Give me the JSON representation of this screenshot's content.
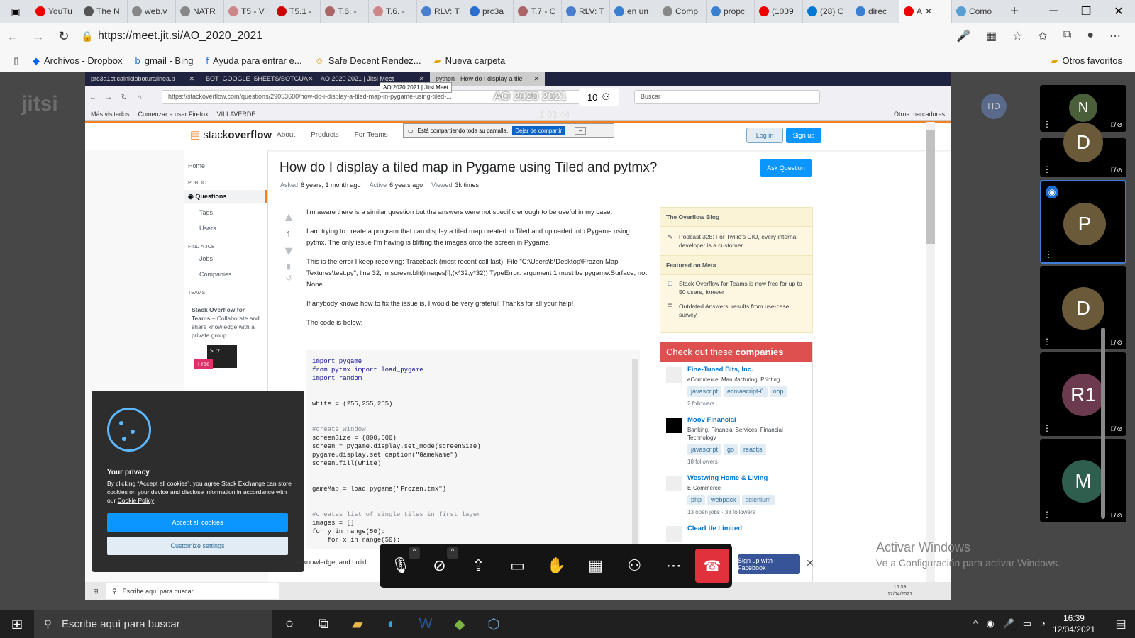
{
  "browser": {
    "tabs": [
      "YouTu",
      "The N",
      "web.v",
      "NATR",
      "T5 - V",
      "T5.1 -",
      "T.6. -",
      "T.6. -",
      "RLV: T",
      "prc3a",
      "T.7 - C",
      "RLV: T",
      "en un",
      "Comp",
      "propc",
      "(1039",
      "(28) C",
      "direc",
      "A",
      "Como"
    ],
    "active_tab_index": 18,
    "url": "https://meet.jit.si/AO_2020_2021",
    "favorites": [
      "Archivos - Dropbox",
      "gmail - Bing",
      "Ayuda para entrar e...",
      "Safe Decent Rendez...",
      "Nueva carpeta"
    ],
    "other_favorites": "Otros favoritos"
  },
  "meet": {
    "logo": "jitsi",
    "title": "AO 2020 2021",
    "timer": "1:03:44",
    "participant_count": "10",
    "self_initials": "HD",
    "tooltip": "AO 2020 2021 | Jitsi Meet",
    "sharing_text": "Está compartiendo toda su pantalla.",
    "stop_sharing": "Dejar de compartir",
    "participants": [
      {
        "initial": "N",
        "color": "#4a5e3a"
      },
      {
        "initial": "D",
        "color": "#6b5a3a"
      },
      {
        "initial": "P",
        "color": "#6b5a3a"
      },
      {
        "initial": "D",
        "color": "#6b5a3a"
      },
      {
        "initial": "R1",
        "color": "#6b3a4e"
      },
      {
        "initial": "M",
        "color": "#2e5e4e"
      }
    ],
    "activate_windows_title": "Activar Windows",
    "activate_windows_sub": "Ve a Configuración para activar Windows."
  },
  "shared": {
    "ff_tabs": [
      "prc3a1cticainicioboturalinea.p",
      "BOT_GOOGLE_SHEETS/BOTGUA",
      "AO 2020 2021 | Jitsi Meet",
      "python - How do I display a tile"
    ],
    "ff_url": "https://stackoverflow.com/questions/29053680/how-do-i-display-a-tiled-map-in-pygame-using-tiled-...",
    "ff_search": "Buscar",
    "ff_bookmarks": [
      "Más visitados",
      "Comenzar a usar Firefox",
      "VILLAVERDE"
    ],
    "ff_other_bm": "Otros marcadores",
    "so": {
      "logo_a": "stack",
      "logo_b": "overflow",
      "nav": [
        "About",
        "Products",
        "For Teams"
      ],
      "login": "Log in",
      "signup": "Sign up",
      "sidebar": {
        "home": "Home",
        "public": "PUBLIC",
        "questions": "Questions",
        "tags": "Tags",
        "users": "Users",
        "find_job": "FIND A JOB",
        "jobs": "Jobs",
        "companies": "Companies",
        "teams": "TEAMS",
        "teams_title": "Stack Overflow for Teams",
        "teams_desc": " – Collaborate and share knowledge with a private group.",
        "free": "Free"
      },
      "question_title": "How do I display a tiled map in Pygame using Tiled and pytmx?",
      "ask_button": "Ask Question",
      "asked_label": "Asked",
      "asked_value": "6 years, 1 month ago",
      "active_label": "Active",
      "active_value": "6 years ago",
      "viewed_label": "Viewed",
      "viewed_value": "3k times",
      "score": "1",
      "paragraphs": [
        "I'm aware there is a similar question but the answers were not specific enough to be useful in my case.",
        "I am trying to create a program that can display a tiled map created in Tiled and uploaded into Pygame using pytmx. The only issue I'm having is blitting the images onto the screen in Pygame.",
        "This is the error I keep receiving: Traceback (most recent call last): File \"C:\\Users\\b\\Desktop\\Frozen Map Textures\\test.py\", line 32, in screen.blit(images[i],(x*32,y*32)) TypeError: argument 1 must be pygame.Surface, not None",
        "If anybody knows how to fix the issue is, I would be very grateful! Thanks for all your help!",
        "The code is below:"
      ],
      "code": [
        "import pygame",
        "from pytmx import load_pygame",
        "import random",
        "",
        "",
        "white = (255,255,255)",
        "",
        "",
        "#create window",
        "screenSize = (800,600)",
        "screen = pygame.display.set_mode(screenSize)",
        "pygame.display.set_caption(\"GameName\")",
        "screen.fill(white)",
        "",
        "",
        "gameMap = load_pygame(\"Frozen.tmx\")",
        "",
        "",
        "#creates list of single tiles in first layer",
        "images = []",
        "for y in range(50):",
        "    for x in range(50):"
      ],
      "blog": {
        "title": "The Overflow Blog",
        "item1": "Podcast 328: For Twilio's CIO, every internal developer is a customer",
        "meta_title": "Featured on Meta",
        "item2": "Stack Overflow for Teams is now free for up to 50 users, forever",
        "item3": "Outdated Answers: results from use-case survey"
      },
      "companies_title_a": "Check out these ",
      "companies_title_b": "companies",
      "companies": [
        {
          "name": "Fine-Tuned Bits, Inc.",
          "industry": "eCommerce, Manufacturing, Printing",
          "tags": [
            "javascript",
            "ecmascript-6",
            "oop"
          ],
          "followers": "2 followers"
        },
        {
          "name": "Moov Financial",
          "industry": "Banking, Financial Services, Financial Technology",
          "tags": [
            "javascript",
            "go",
            "reactjs"
          ],
          "followers": "18 followers"
        },
        {
          "name": "Westwing Home & Living",
          "industry": "E-Commerce",
          "tags": [
            "php",
            "webpack",
            "selenium"
          ],
          "followers": "13 open jobs · 38 followers"
        },
        {
          "name": "ClearLife Limited",
          "industry": "",
          "tags": [],
          "followers": ""
        }
      ],
      "cookie": {
        "title": "Your privacy",
        "text": "By clicking “Accept all cookies”, you agree Stack Exchange can store cookies on your device and disclose information in accordance with our ",
        "link": "Cookie Policy",
        "accept": "Accept all cookies",
        "customize": "Customize settings"
      },
      "bottom_banner": "re knowledge, and build",
      "facebook": "Sign up with Facebook"
    },
    "inner_taskbar": {
      "search": "Escribe aquí para buscar",
      "time": "16:39",
      "date": "12/04/2021"
    }
  },
  "taskbar": {
    "search": "Escribe aquí para buscar",
    "time": "16:39",
    "date": "12/04/2021"
  }
}
